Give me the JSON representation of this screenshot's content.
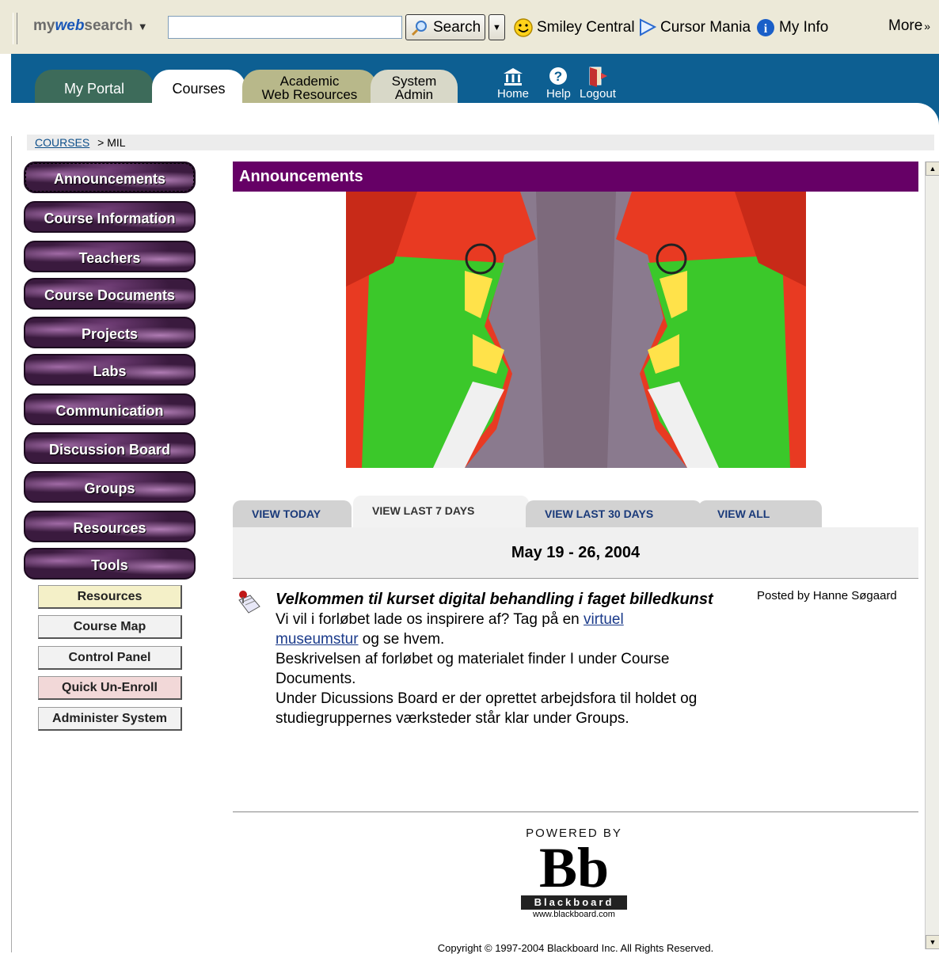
{
  "toolbar": {
    "logo_my": "my",
    "logo_web": "web",
    "logo_search": "search",
    "search_value": "",
    "search_label": "Search",
    "items": [
      {
        "label": "Smiley Central",
        "icon": "smiley-icon"
      },
      {
        "label": "Cursor Mania",
        "icon": "cursor-icon"
      },
      {
        "label": "My Info",
        "icon": "info-icon"
      }
    ],
    "more_label": "More"
  },
  "header": {
    "tabs": [
      {
        "label": "My Portal"
      },
      {
        "label": "Courses"
      },
      {
        "label_line1": "Academic",
        "label_line2": "Web Resources"
      },
      {
        "label_line1": "System",
        "label_line2": "Admin"
      }
    ],
    "icons": [
      {
        "label": "Home",
        "icon": "home-icon"
      },
      {
        "label": "Help",
        "icon": "help-icon"
      },
      {
        "label": "Logout",
        "icon": "logout-icon"
      }
    ]
  },
  "breadcrumb": {
    "link": "COURSES",
    "separator": ">",
    "current": "MIL"
  },
  "nav": {
    "items": [
      {
        "label": "Announcements"
      },
      {
        "label": "Course Information"
      },
      {
        "label": "Teachers"
      },
      {
        "label": "Course Documents"
      },
      {
        "label": "Projects"
      },
      {
        "label": "Labs"
      },
      {
        "label": "Communication"
      },
      {
        "label": "Discussion Board"
      },
      {
        "label": "Groups"
      },
      {
        "label": "Resources"
      },
      {
        "label": "Tools"
      }
    ],
    "sub_items": [
      {
        "label": "Resources",
        "bg": "#f4f0c8"
      },
      {
        "label": "Course Map",
        "bg": "#f2f2f2"
      },
      {
        "label": "Control Panel",
        "bg": "#f2f2f2"
      },
      {
        "label": "Quick Un-Enroll",
        "bg": "#f2d8d8"
      },
      {
        "label": "Administer System",
        "bg": "#f2f2f2"
      }
    ]
  },
  "main": {
    "section_title": "Announcements",
    "view_tabs": [
      {
        "label": "VIEW TODAY"
      },
      {
        "label": "VIEW LAST 7 DAYS"
      },
      {
        "label": "VIEW LAST 30 DAYS"
      },
      {
        "label": "VIEW ALL"
      }
    ],
    "date_range": "May 19 - 26, 2004",
    "post": {
      "title": "Velkommen til kurset digital behandling i faget billedkunst",
      "posted_by": "Posted by  Hanne Søgaard",
      "line1_a": "Vi vil i forløbet lade os inspirere af? Tag på en ",
      "link1": "virtuel",
      "link2": "museumstur",
      "line2_b": " og se hvem.",
      "line3": "Beskrivelsen af forløbet og materialet finder I under Course Documents.",
      "line4": "Under Dicussions Board er der oprettet arbejdsfora til holdet og studiegruppernes værksteder står klar under Groups."
    },
    "footer": {
      "powered_by": "POWERED BY",
      "logo_letters": "Bb",
      "logo_word": "Blackboard",
      "logo_url": "www.blackboard.com",
      "copyright": "Copyright © 1997-2004 Blackboard Inc. All Rights Reserved."
    }
  },
  "colors": {
    "header_blue": "#0d5f92",
    "announcement_bar": "#660066",
    "link": "#1a3a8a"
  }
}
